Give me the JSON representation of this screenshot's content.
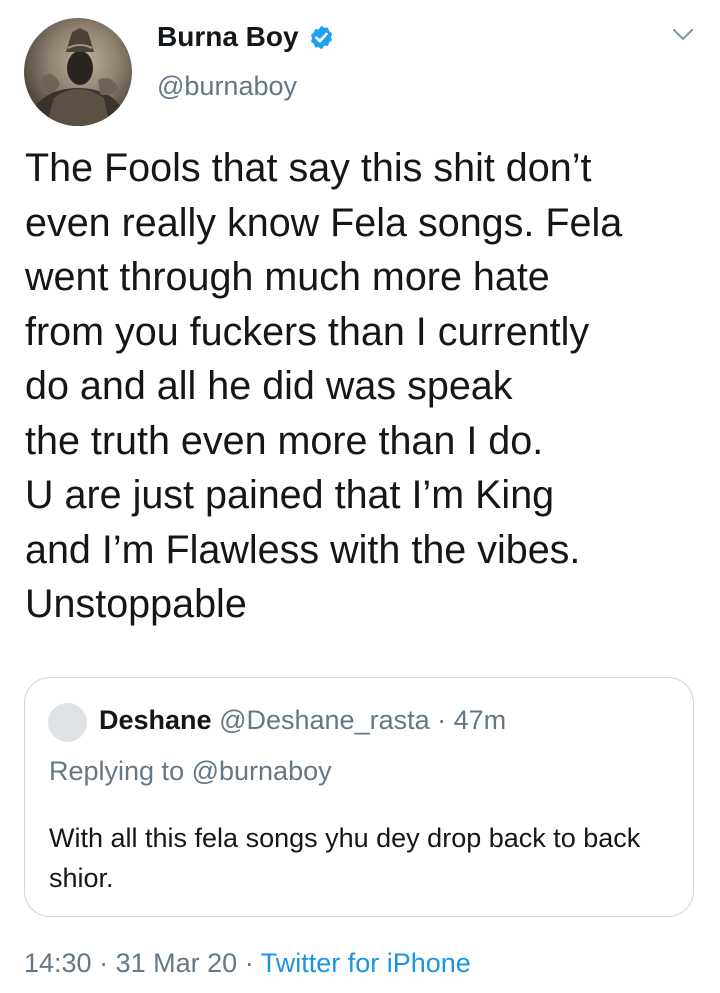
{
  "author": {
    "name": "Burna Boy",
    "handle": "@burnaboy",
    "verified": true
  },
  "tweet": {
    "text": "The Fools that say this shit don’t\neven really know Fela songs. Fela\nwent through much more hate\nfrom you fuckers than I currently\ndo and all he did was speak\nthe truth even more than I do.\nU are just pained that I’m King\nand I’m Flawless with the vibes.\nUnstoppable"
  },
  "quoted_tweet": {
    "name": "Deshane",
    "handle": "@Deshane_rasta",
    "separator": "·",
    "time": "47m",
    "replying_label": "Replying to",
    "replying_to": "@burnaboy",
    "text": "With all this fela songs yhu dey drop back to back shior."
  },
  "footer": {
    "time": "14:30",
    "sep1": "·",
    "date": "31 Mar 20",
    "sep2": "·",
    "source": "Twitter for iPhone"
  },
  "colors": {
    "verified_badge": "#1da1f2",
    "link": "#1b95e0",
    "secondary_text": "#657786",
    "border": "#ccd6dd"
  },
  "icons": [
    "avatar-photo",
    "verified-badge-icon",
    "chevron-down-icon"
  ]
}
